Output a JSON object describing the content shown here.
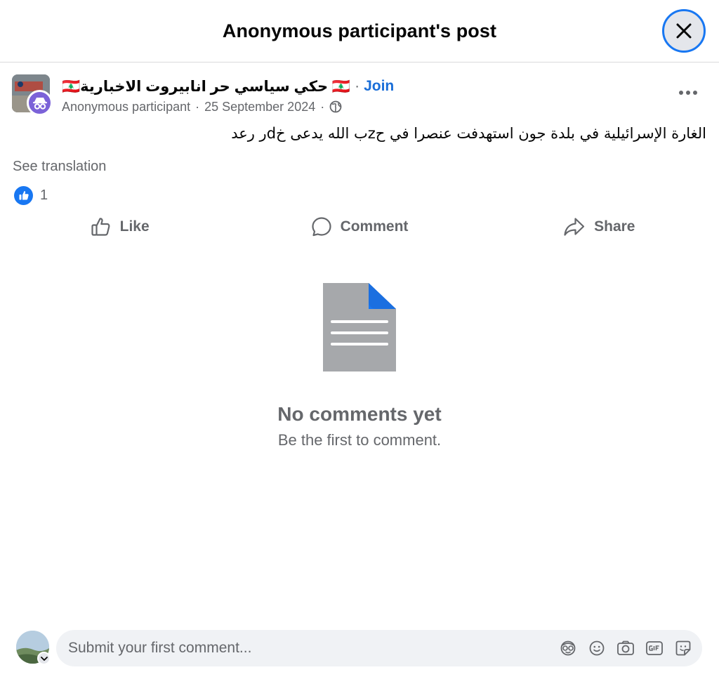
{
  "header": {
    "title": "Anonymous participant's post"
  },
  "post": {
    "group_name": "🇱🇧 حكي سياسي حر انابيروت الاخبارية🇱🇧",
    "separator": "·",
    "join_label": "Join",
    "author": "Anonymous participant",
    "date": "25 September 2024",
    "audience_icon": "globe-icon",
    "text": "الغارة الإسرائيلية في بلدة جون استهدفت عنصرا في حzب الله يدعى خdر رعد",
    "see_translation": "See translation",
    "reaction_count": "1"
  },
  "actions": {
    "like": "Like",
    "comment": "Comment",
    "share": "Share"
  },
  "empty_state": {
    "title": "No comments yet",
    "subtitle": "Be the first to comment."
  },
  "composer": {
    "placeholder": "Submit your first comment...",
    "icons": [
      "avatar-sticker-icon",
      "emoji-icon",
      "camera-icon",
      "gif-icon",
      "sticker-icon"
    ]
  },
  "colors": {
    "accent": "#1877f2",
    "anon_badge": "#7b62d8",
    "secondary_text": "#65676b"
  }
}
